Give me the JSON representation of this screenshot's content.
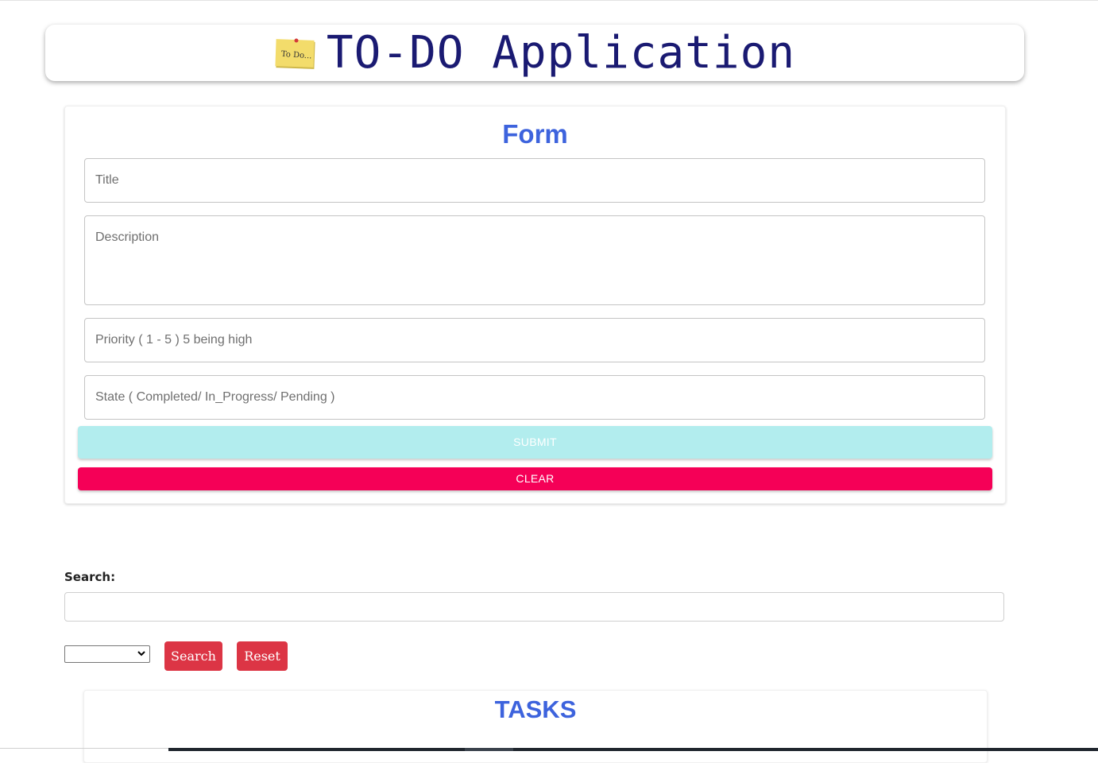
{
  "header": {
    "title": "TO-DO Application",
    "logo_text": "To Do..."
  },
  "form": {
    "heading": "Form",
    "title_placeholder": "Title",
    "description_placeholder": "Description",
    "priority_placeholder": "Priority ( 1 - 5 ) 5 being high",
    "state_placeholder": "State ( Completed/ In_Progress/ Pending )",
    "submit_label": "SUBMIT",
    "clear_label": "CLEAR"
  },
  "search": {
    "label": "Search:",
    "value": "",
    "select_value": "",
    "search_button": "Search",
    "reset_button": "Reset"
  },
  "tasks": {
    "heading": "TASKS"
  },
  "colors": {
    "heading_blue": "#3d63dd",
    "header_title": "#1a1a72",
    "submit_bg": "#b2edee",
    "clear_bg": "#f50057",
    "button_red": "#dc3545"
  }
}
